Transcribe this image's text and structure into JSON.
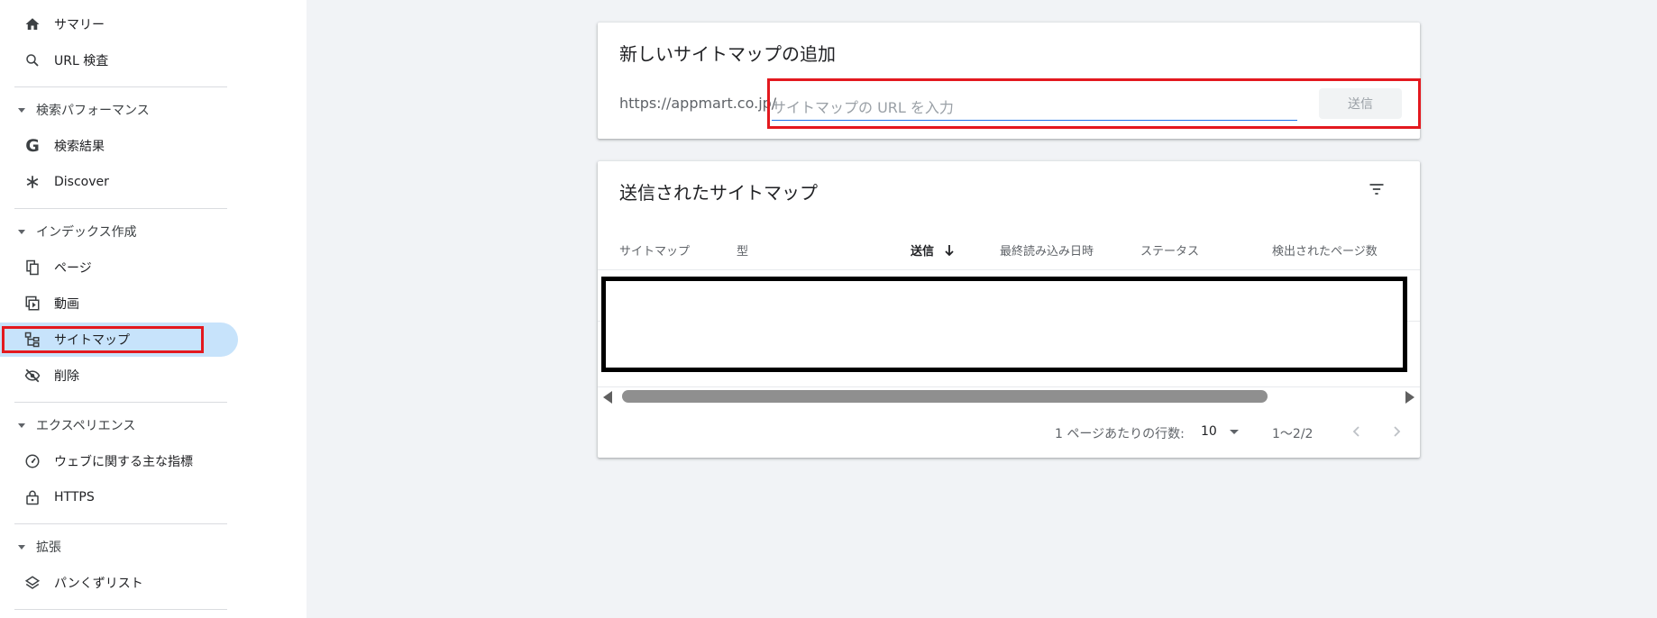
{
  "sidebar": {
    "summary": "サマリー",
    "url_inspection": "URL 検査",
    "sections": {
      "search_performance": "検索パフォーマンス",
      "indexing": "インデックス作成",
      "experience": "エクスペリエンス",
      "enhancements": "拡張"
    },
    "items": {
      "search_results": "検索結果",
      "discover": "Discover",
      "pages": "ページ",
      "videos": "動画",
      "sitemaps": "サイトマップ",
      "removals": "削除",
      "core_web_vitals": "ウェブに関する主な指標",
      "https": "HTTPS",
      "breadcrumbs": "パンくずリスト"
    },
    "active": "sitemaps"
  },
  "add_card": {
    "title": "新しいサイトマップの追加",
    "url_prefix": "https://appmart.co.jp/",
    "input_placeholder": "サイトマップの URL を入力",
    "input_value": "",
    "submit_label": "送信"
  },
  "submitted_card": {
    "title": "送信されたサイトマップ",
    "columns": [
      "サイトマップ",
      "型",
      "送信",
      "最終読み込み日時",
      "ステータス",
      "検出されたページ数"
    ],
    "sorted_column": "送信",
    "sort_direction": "descending",
    "rows_per_page_label": "1 ページあたりの行数:",
    "rows_per_page_value": "10",
    "range_label": "1〜2/2"
  },
  "colors": {
    "accent": "#1a73e8",
    "active_nav": "#c7e3fb",
    "highlight_red": "#e3191f"
  }
}
